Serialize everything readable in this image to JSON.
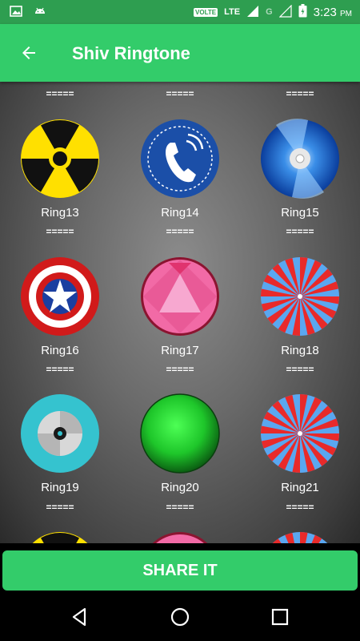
{
  "status_bar": {
    "volte": "VOLTE",
    "lte": "LTE",
    "g": "G",
    "time": "3:23",
    "ampm": "PM"
  },
  "app_bar": {
    "title": "Shiv Ringtone"
  },
  "grid": {
    "separator": "=====",
    "rings": [
      {
        "label": "Ring13",
        "icon": "radiation-icon"
      },
      {
        "label": "Ring14",
        "icon": "phone-icon"
      },
      {
        "label": "Ring15",
        "icon": "disc-icon"
      },
      {
        "label": "Ring16",
        "icon": "shield-star-icon"
      },
      {
        "label": "Ring17",
        "icon": "triangle-gem-icon"
      },
      {
        "label": "Ring18",
        "icon": "spiral-icon"
      },
      {
        "label": "Ring19",
        "icon": "cd-icon"
      },
      {
        "label": "Ring20",
        "icon": "green-ball-icon"
      },
      {
        "label": "Ring21",
        "icon": "spiral-icon"
      }
    ]
  },
  "share_button": {
    "label": "SHARE IT"
  },
  "colors": {
    "primary": "#33cc6a",
    "status": "#2e9e50"
  }
}
